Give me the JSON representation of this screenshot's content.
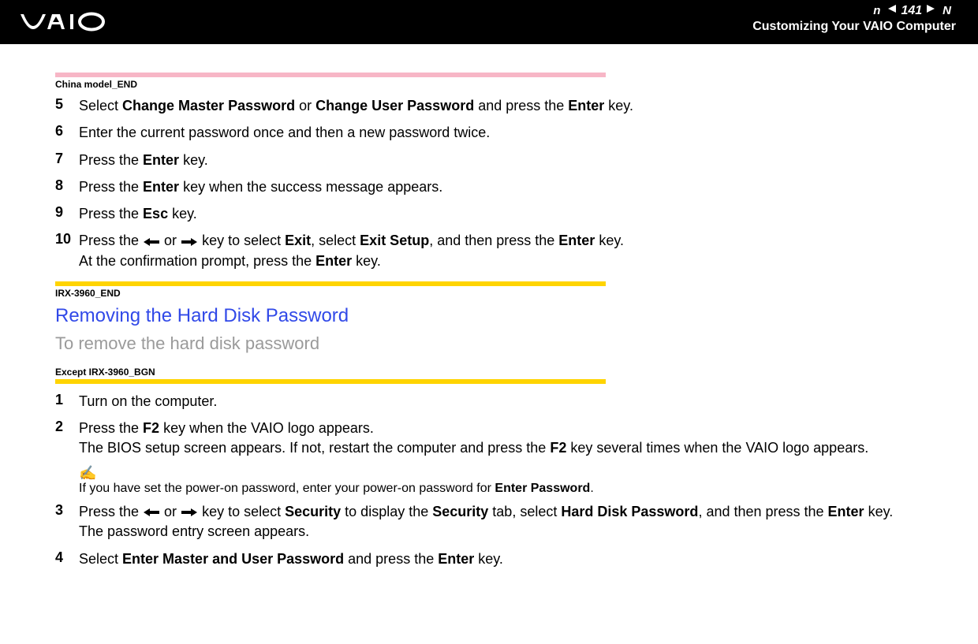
{
  "header": {
    "page_number": "141",
    "n_letter": "n",
    "N_letter": "N",
    "title": "Customizing Your VAIO Computer"
  },
  "tag1": "China model_END",
  "steps_a": [
    {
      "num": "5",
      "parts": [
        {
          "t": "Select "
        },
        {
          "t": "Change Master Password",
          "b": true
        },
        {
          "t": " or "
        },
        {
          "t": "Change User Password",
          "b": true
        },
        {
          "t": " and press the "
        },
        {
          "t": "Enter",
          "b": true
        },
        {
          "t": " key."
        }
      ]
    },
    {
      "num": "6",
      "parts": [
        {
          "t": "Enter the current password once and then a new password twice."
        }
      ]
    },
    {
      "num": "7",
      "parts": [
        {
          "t": "Press the "
        },
        {
          "t": "Enter",
          "b": true
        },
        {
          "t": " key."
        }
      ]
    },
    {
      "num": "8",
      "parts": [
        {
          "t": "Press the "
        },
        {
          "t": "Enter",
          "b": true
        },
        {
          "t": " key when the success message appears."
        }
      ]
    },
    {
      "num": "9",
      "parts": [
        {
          "t": "Press the "
        },
        {
          "t": "Esc",
          "b": true
        },
        {
          "t": " key."
        }
      ]
    },
    {
      "num": "10",
      "parts": [
        {
          "t": "Press the "
        },
        {
          "arrow": "left"
        },
        {
          "t": " or "
        },
        {
          "arrow": "right"
        },
        {
          "t": " key to select "
        },
        {
          "t": "Exit",
          "b": true
        },
        {
          "t": ", select "
        },
        {
          "t": "Exit Setup",
          "b": true
        },
        {
          "t": ", and then press the "
        },
        {
          "t": "Enter",
          "b": true
        },
        {
          "t": " key."
        }
      ],
      "line2": [
        {
          "t": "At the confirmation prompt, press the "
        },
        {
          "t": "Enter",
          "b": true
        },
        {
          "t": " key."
        }
      ]
    }
  ],
  "tag2": "IRX-3960_END",
  "heading_blue": "Removing the Hard Disk Password",
  "heading_gray": "To remove the hard disk password",
  "tag3": "Except IRX-3960_BGN",
  "steps_b": [
    {
      "num": "1",
      "parts": [
        {
          "t": "Turn on the computer."
        }
      ]
    },
    {
      "num": "2",
      "parts": [
        {
          "t": "Press the "
        },
        {
          "t": "F2",
          "b": true
        },
        {
          "t": " key when the VAIO logo appears."
        }
      ],
      "line2": [
        {
          "t": "The BIOS setup screen appears. If not, restart the computer and press the "
        },
        {
          "t": "F2",
          "b": true
        },
        {
          "t": " key several times when the VAIO logo appears."
        }
      ]
    }
  ],
  "note": {
    "icon": "✍",
    "parts": [
      {
        "t": "If you have set the power-on password, enter your power-on password for "
      },
      {
        "t": "Enter Password",
        "b": true
      },
      {
        "t": "."
      }
    ]
  },
  "steps_c": [
    {
      "num": "3",
      "parts": [
        {
          "t": "Press the "
        },
        {
          "arrow": "left"
        },
        {
          "t": " or "
        },
        {
          "arrow": "right"
        },
        {
          "t": " key to select "
        },
        {
          "t": "Security",
          "b": true
        },
        {
          "t": " to display the "
        },
        {
          "t": "Security",
          "b": true
        },
        {
          "t": " tab, select "
        },
        {
          "t": "Hard Disk Password",
          "b": true
        },
        {
          "t": ", and then press the "
        },
        {
          "t": "Enter",
          "b": true
        },
        {
          "t": " key."
        }
      ],
      "line2": [
        {
          "t": "The password entry screen appears."
        }
      ]
    },
    {
      "num": "4",
      "parts": [
        {
          "t": "Select "
        },
        {
          "t": "Enter Master and User Password",
          "b": true
        },
        {
          "t": " and press the "
        },
        {
          "t": "Enter",
          "b": true
        },
        {
          "t": " key."
        }
      ]
    }
  ]
}
